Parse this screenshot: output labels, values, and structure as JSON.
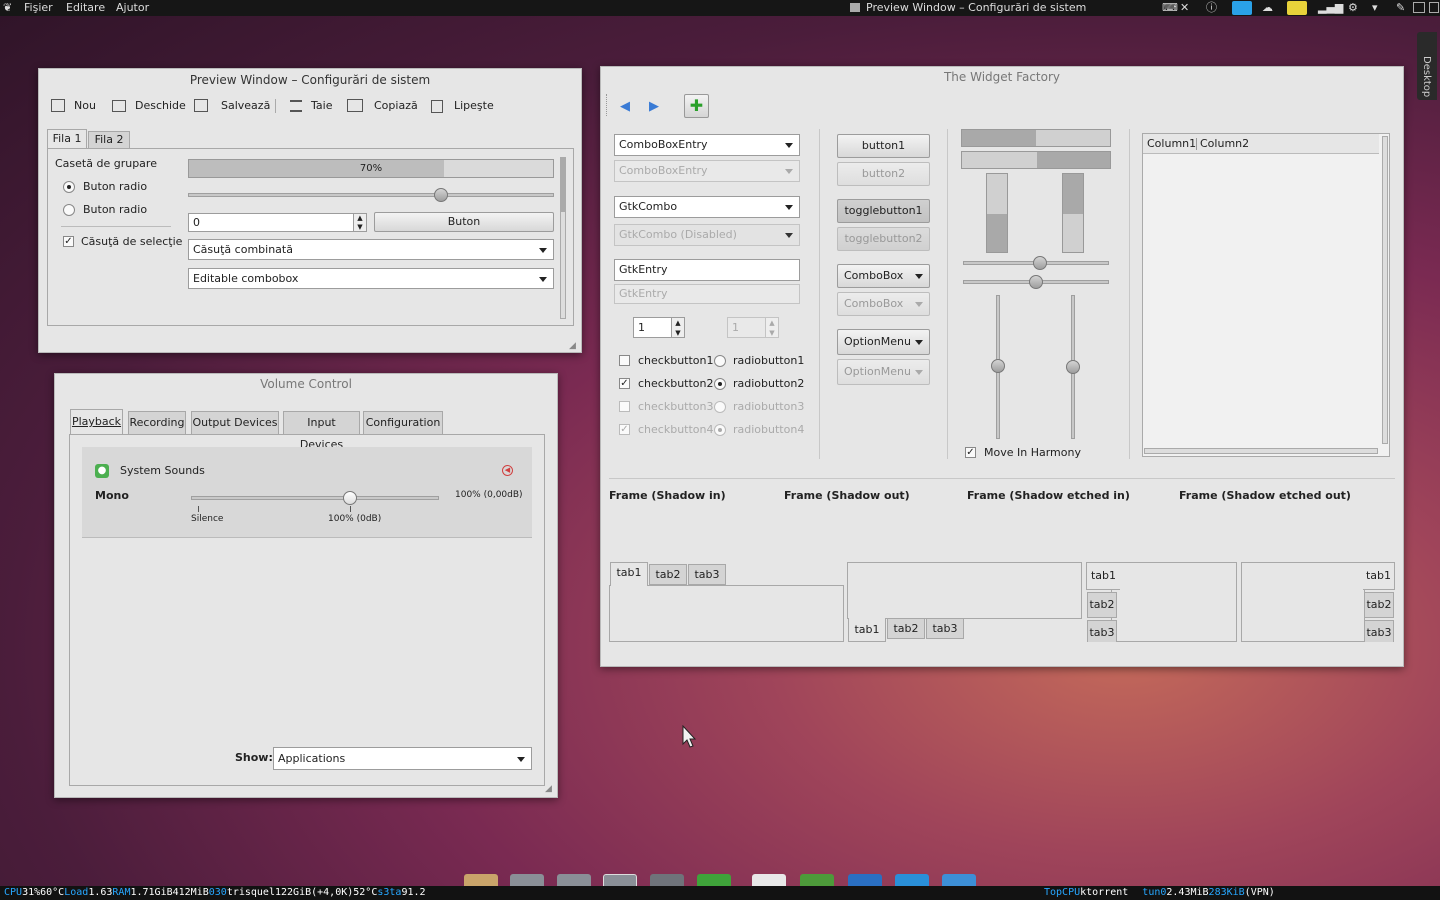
{
  "top_panel": {
    "menu": [
      "Fişier",
      "Editare",
      "Ajutor"
    ],
    "active_window_title": "Preview Window – Configurări de sistem"
  },
  "desktop_label": "Desktop",
  "preview_window": {
    "title": "Preview Window – Configurări de sistem",
    "toolbar": [
      "Nou",
      "Deschide",
      "Salvează",
      "Taie",
      "Copiază",
      "Lipeşte"
    ],
    "tabs": [
      "Fila 1",
      "Fila 2"
    ],
    "group_label": "Casetă de grupare",
    "radios": [
      "Buton radio",
      "Buton radio"
    ],
    "checkbox_label": "Căsuţă de selecţie",
    "progress_text": "70%",
    "progress_value": 0.7,
    "slider_value": 0.69,
    "spin_value": "0",
    "button_label": "Buton",
    "combo_value": "Căsuţă combinată",
    "editable_combo_value": "Editable combobox"
  },
  "volume_control": {
    "title": "Volume Control",
    "tabs": [
      "Playback",
      "Recording",
      "Output Devices",
      "Input Devices",
      "Configuration"
    ],
    "stream_name": "System Sounds",
    "channel_label": "Mono",
    "level_text": "100% (0,00dB)",
    "mark_silence": "Silence",
    "mark_100": "100% (0dB)",
    "slider_value": 0.64,
    "show_label": "Show:",
    "show_value": "Applications"
  },
  "widget_factory": {
    "title": "The Widget Factory",
    "combo_box_entry": "ComboBoxEntry",
    "combo_box_entry_disabled": "ComboBoxEntry",
    "gtk_combo": "GtkCombo",
    "gtk_combo_disabled": "GtkCombo (Disabled)",
    "gtk_entry": "GtkEntry",
    "gtk_entry_disabled": "GtkEntry",
    "spin1": "1",
    "spin2": "1",
    "checks": [
      "checkbutton1",
      "checkbutton2",
      "checkbutton3",
      "checkbutton4"
    ],
    "radios": [
      "radiobutton1",
      "radiobutton2",
      "radiobutton3",
      "radiobutton4"
    ],
    "buttons": [
      "button1",
      "button2"
    ],
    "togglebuttons": [
      "togglebutton1",
      "togglebutton2"
    ],
    "combobox": "ComboBox",
    "combobox_disabled": "ComboBox",
    "optionmenu": "OptionMenu",
    "optionmenu_disabled": "OptionMenu",
    "move_in_harmony": "Move In Harmony",
    "columns": [
      "Column1",
      "Column2"
    ],
    "frames": [
      "Frame (Shadow in)",
      "Frame (Shadow out)",
      "Frame (Shadow etched in)",
      "Frame (Shadow etched out)"
    ],
    "notebook_tabs": [
      "tab1",
      "tab2",
      "tab3"
    ]
  },
  "status_bar": {
    "segments": [
      {
        "text": "CPU",
        "color": "#27a7ff"
      },
      {
        "text": "31%",
        "color": "#ffffff"
      },
      {
        "text": "60°C",
        "color": "#ffffff"
      },
      {
        "text": "Load",
        "color": "#27a7ff"
      },
      {
        "text": "1.63",
        "color": "#ffffff"
      },
      {
        "text": "RAM",
        "color": "#27a7ff"
      },
      {
        "text": "1.71GiB",
        "color": "#ffffff"
      },
      {
        "text": "412MiB",
        "color": "#ffffff"
      },
      {
        "text": "030",
        "color": "#27a7ff"
      },
      {
        "text": "trisquel",
        "color": "#ffffff"
      },
      {
        "text": "122GiB",
        "color": "#ffffff"
      },
      {
        "text": "(+4,0K)",
        "color": "#ffffff"
      },
      {
        "text": "52°C",
        "color": "#ffffff"
      },
      {
        "text": "s3ta",
        "color": "#27a7ff"
      },
      {
        "text": "91.2",
        "color": "#ffffff"
      }
    ],
    "right_segments": [
      {
        "text": "TopCPU",
        "color": "#27a7ff"
      },
      {
        "text": "ktorrent",
        "color": "#ffffff"
      },
      {
        "text": "tun0",
        "color": "#27a7ff"
      },
      {
        "text": "2.43MiB",
        "color": "#ffffff"
      },
      {
        "text": "283KiB",
        "color": "#27a7ff"
      },
      {
        "text": "(VPN)",
        "color": "#ffffff"
      }
    ]
  },
  "dock_icons": [
    "folder-icon",
    "toggle-icon",
    "toggle-icon",
    "toggle-icon",
    "settings-icon",
    "back-icon",
    "text-editor-icon",
    "globe-icon",
    "mail-icon",
    "chat-icon",
    "files-icon"
  ]
}
